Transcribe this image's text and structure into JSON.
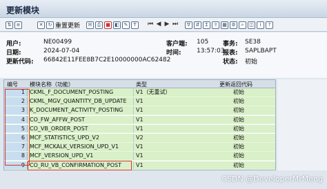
{
  "window": {
    "title": "更新模块"
  },
  "toolbar": {
    "refresh_label": "重置更新"
  },
  "header": {
    "user_label": "用户:",
    "user_value": "NE00499",
    "date_label": "日期:",
    "date_value": "2024-07-04",
    "code_label": "更新代码:",
    "code_value": "66842E11FEE8B7C2E10000000AC62482",
    "client_label": "客户端:",
    "client_value": "105",
    "time_label": "时间:",
    "time_value": "13:57:03",
    "txn_label": "事务:",
    "txn_value": "SE38",
    "report_label": "报表:",
    "report_value": "SAPLBAPT",
    "status_label": "状态:",
    "status_value": "初始"
  },
  "table": {
    "columns": [
      "编号",
      "模块名称（功能）",
      "类型",
      "更新返回代码"
    ],
    "rows": [
      {
        "no": "1",
        "module": "CKML_F_DOCUMENT_POSTING",
        "type": "V1（无重试）",
        "rc": "初始"
      },
      {
        "no": "2",
        "module": "CKML_MGV_QUANTITY_DB_UPDATE",
        "type": "V1",
        "rc": "初始"
      },
      {
        "no": "3",
        "module": "K_DOCUMENT_ACTIVITY_POSTING",
        "type": "V1",
        "rc": "初始"
      },
      {
        "no": "4",
        "module": "CO_FW_AFFW_POST",
        "type": "V1",
        "rc": "初始"
      },
      {
        "no": "5",
        "module": "CO_VB_ORDER_POST",
        "type": "V1",
        "rc": "初始"
      },
      {
        "no": "6",
        "module": "MCF_STATISTICS_UPD_V2",
        "type": "V2",
        "rc": "初始"
      },
      {
        "no": "7",
        "module": "MCF_MCKALK_VERSION_UPD_V1",
        "type": "V1",
        "rc": "初始"
      },
      {
        "no": "8",
        "module": "MCF_VERSION_UPD_V1",
        "type": "V1",
        "rc": "初始"
      },
      {
        "no": "9",
        "module": "CO_RU_VB_CONFIRMATION_POST",
        "type": "V1",
        "rc": "初始"
      }
    ]
  },
  "watermark": "CSDN @DeveloperMrMeng",
  "colors": {
    "row_bg": "#d9f0c8",
    "highlight": "#d9342b",
    "title_bg": "#c9d6e4"
  }
}
